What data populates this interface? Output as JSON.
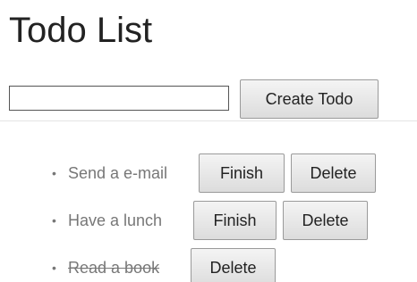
{
  "header": {
    "title": "Todo List"
  },
  "create": {
    "input_value": "",
    "input_placeholder": "",
    "button_label": "Create Todo"
  },
  "todos": [
    {
      "text": "Send a e-mail",
      "done": false,
      "finish_label": "Finish",
      "delete_label": "Delete"
    },
    {
      "text": "Have a lunch",
      "done": false,
      "finish_label": "Finish",
      "delete_label": "Delete"
    },
    {
      "text": "Read a book",
      "done": true,
      "delete_label": "Delete"
    }
  ],
  "bullet_glyph": "•"
}
